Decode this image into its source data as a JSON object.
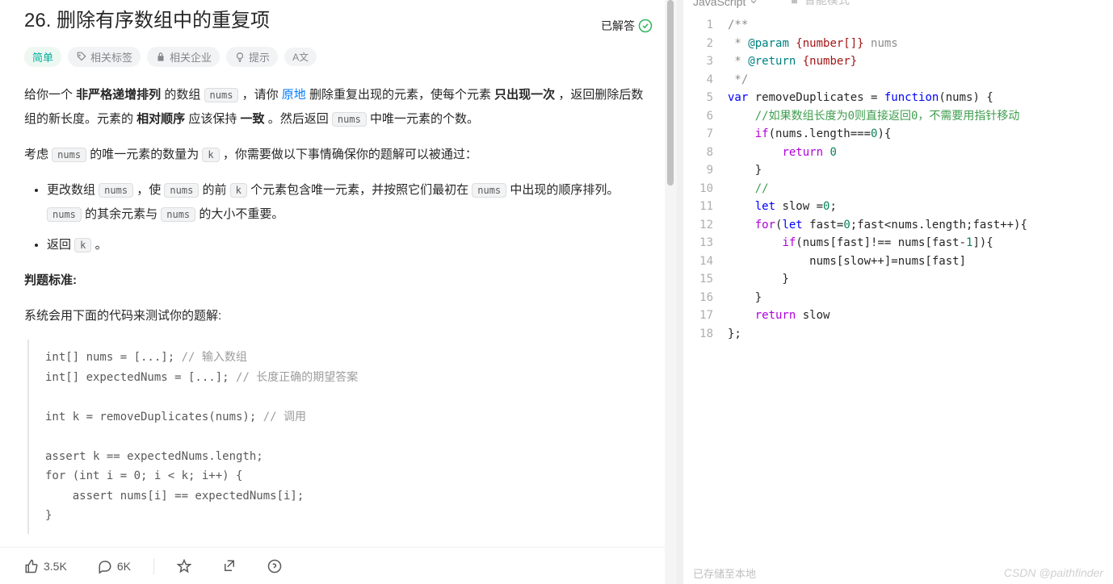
{
  "problem": {
    "title": "26. 删除有序数组中的重复项",
    "status": "已解答",
    "difficulty": "简单",
    "meta": {
      "tags": "相关标签",
      "companies": "相关企业",
      "hints": "提示",
      "icon_letter": "A文"
    },
    "desc": {
      "p1_pre": "给你一个 ",
      "p1_b1": "非严格递增排列",
      "p1_mid1": " 的数组 ",
      "p1_code1": "nums",
      "p1_mid2": " ，请你 ",
      "p1_link": "原地",
      "p1_mid3": " 删除重复出现的元素，使每个元素 ",
      "p1_b2": "只出现一次",
      "p1_mid4": " ，返回删除后数组的新长度。元素的 ",
      "p1_b3": "相对顺序",
      "p1_mid5": " 应该保持 ",
      "p1_b4": "一致",
      "p1_mid6": " 。然后返回 ",
      "p1_code2": "nums",
      "p1_end": " 中唯一元素的个数。",
      "p2_pre": "考虑 ",
      "p2_code1": "nums",
      "p2_mid": " 的唯一元素的数量为 ",
      "p2_code2": "k",
      "p2_end": " ，你需要做以下事情确保你的题解可以被通过：",
      "li1_pre": "更改数组 ",
      "li1_c1": "nums",
      "li1_m1": " ，使 ",
      "li1_c2": "nums",
      "li1_m2": " 的前 ",
      "li1_c3": "k",
      "li1_m3": " 个元素包含唯一元素，并按照它们最初在 ",
      "li1_c4": "nums",
      "li1_m4": " 中出现的顺序排列。",
      "li1_c5": "nums",
      "li1_m5": " 的其余元素与 ",
      "li1_c6": "nums",
      "li1_end": " 的大小不重要。",
      "li2_pre": "返回 ",
      "li2_code": "k",
      "li2_end": " 。",
      "judge_title": "判题标准:",
      "judge_desc": "系统会用下面的代码来测试你的题解:"
    },
    "testcode": {
      "l1a": "int[] nums = [...]; ",
      "l1b": "// 输入数组",
      "l2a": "int[] expectedNums = [...]; ",
      "l2b": "// 长度正确的期望答案",
      "l3": "",
      "l4a": "int k = removeDuplicates(nums); ",
      "l4b": "// 调用",
      "l5": "",
      "l6": "assert k == expectedNums.length;",
      "l7": "for (int i = 0; i < k; i++) {",
      "l8": "    assert nums[i] == expectedNums[i];",
      "l9": "}"
    }
  },
  "bottom": {
    "likes": "3.5K",
    "comments": "6K"
  },
  "editor": {
    "language": "JavaScript",
    "mode": "智能模式",
    "footer": "已存储至本地",
    "watermark": "CSDN @paithfinder",
    "lines": [
      "1",
      "2",
      "3",
      "4",
      "5",
      "6",
      "7",
      "8",
      "9",
      "10",
      "11",
      "12",
      "13",
      "14",
      "15",
      "16",
      "17",
      "18"
    ],
    "code": {
      "l1": "/**",
      "l2_a": " * ",
      "l2_b": "@param",
      "l2_c": " {number[]}",
      "l2_d": " nums",
      "l3_a": " * ",
      "l3_b": "@return",
      "l3_c": " {number}",
      "l4": " */",
      "l5_a": "var",
      "l5_b": " removeDuplicates = ",
      "l5_c": "function",
      "l5_d": "(nums) {",
      "l6_a": "    ",
      "l6_b": "//如果数组长度为0则直接返回0，不需要用指针移动",
      "l7_a": "    ",
      "l7_b": "if",
      "l7_c": "(nums.length===",
      "l7_d": "0",
      "l7_e": "){",
      "l8_a": "        ",
      "l8_b": "return",
      "l8_c": " ",
      "l8_d": "0",
      "l9": "    }",
      "l10_a": "    ",
      "l10_b": "//",
      "l11_a": "    ",
      "l11_b": "let",
      "l11_c": " slow =",
      "l11_d": "0",
      "l11_e": ";",
      "l12_a": "    ",
      "l12_b": "for",
      "l12_c": "(",
      "l12_d": "let",
      "l12_e": " fast=",
      "l12_f": "0",
      "l12_g": ";fast<nums.length;fast++){",
      "l13_a": "        ",
      "l13_b": "if",
      "l13_c": "(nums[fast]!== nums[fast-",
      "l13_d": "1",
      "l13_e": "]){",
      "l14": "            nums[slow++]=nums[fast]",
      "l15": "        }",
      "l16": "    }",
      "l17_a": "    ",
      "l17_b": "return",
      "l17_c": " slow",
      "l18": "};"
    }
  }
}
